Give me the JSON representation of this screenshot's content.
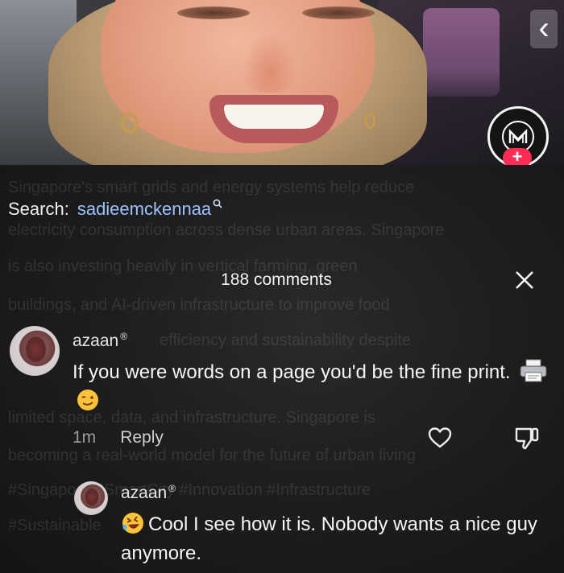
{
  "search": {
    "label": "Search:",
    "query": "sadieemckennaa"
  },
  "comments_panel": {
    "count_label": "188 comments"
  },
  "comments": [
    {
      "username": "azaan",
      "badge": "®",
      "text": "If you were words on a page you'd be the fine print.",
      "emojis": [
        "printer-emoji",
        "winking-face-emoji"
      ],
      "time": "1m",
      "reply_label": "Reply"
    },
    {
      "username": "azaan",
      "badge": "®",
      "text": "Cool I see how it is. Nobody wants a nice guy anymore.",
      "emojis": [
        "rolling-on-floor-laughing-emoji"
      ]
    }
  ],
  "background_text": [
    "Singapore's smart grids and energy systems help reduce",
    "electricity consumption across dense urban areas. Singapore",
    "is also investing heavily in vertical farming, green",
    "buildings, and AI-driven infrastructure to improve food",
    "efficiency and sustainability despite",
    "limited space, data, and infrastructure. Singapore is",
    "becoming a real-world model for the future of urban living",
    "#Singapore #SmartCity #Innovation #Infrastructure",
    "#Sustainable"
  ],
  "colors": {
    "accent_link": "#9fc1ff",
    "follow_plus": "#fe2c55"
  }
}
